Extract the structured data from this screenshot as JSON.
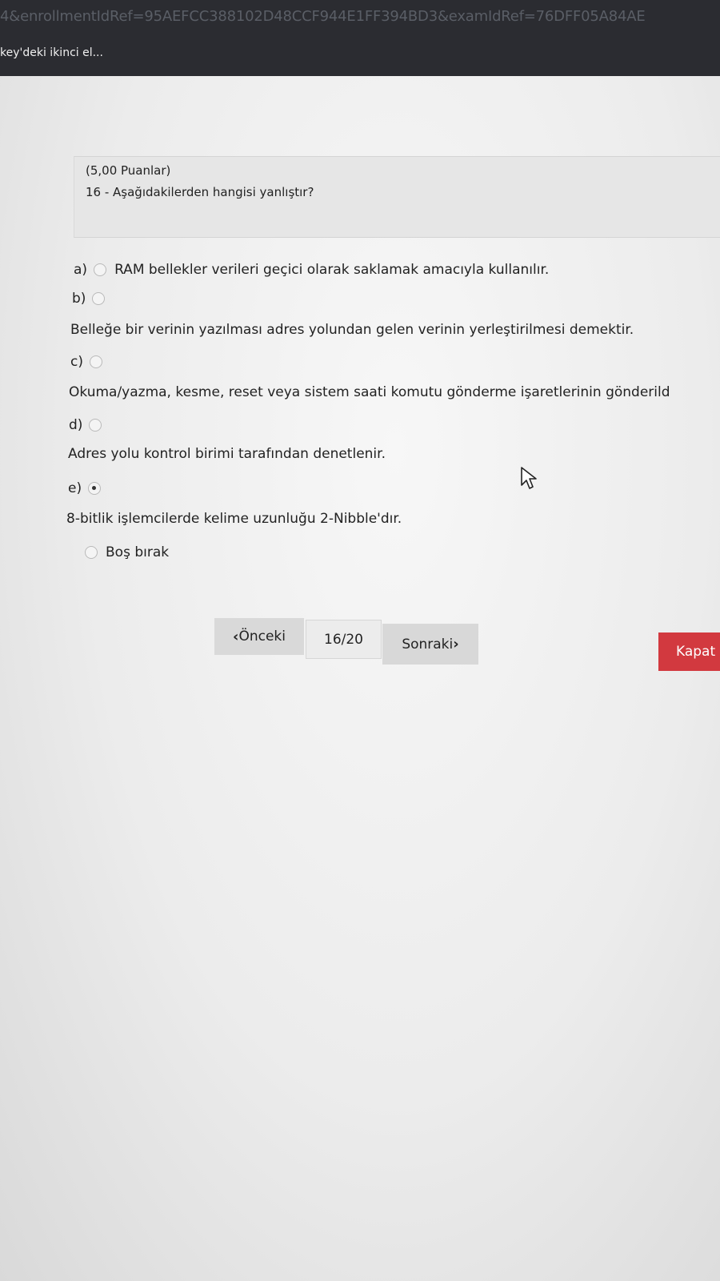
{
  "browser": {
    "url_fragment": "4&enrollmentIdRef=95AEFCC388102D48CCF944E1FF394BD3&examIdRef=76DFF05A84AE",
    "tab_title": "key'deki ikinci el..."
  },
  "question": {
    "points": "(5,00 Puanlar)",
    "text": "16 -  Aşağıdakilerden hangisi yanlıştır?"
  },
  "options": [
    {
      "letter": "a)",
      "text": "RAM bellekler verileri geçici olarak saklamak amacıyla kullanılır.",
      "selected": false
    },
    {
      "letter": "b)",
      "text": "Belleğe bir verinin yazılması adres yolundan gelen verinin yerleştirilmesi demektir.",
      "selected": false
    },
    {
      "letter": "c)",
      "text": "Okuma/yazma, kesme, reset veya sistem saati komutu gönderme işaretlerinin gönderild",
      "selected": false
    },
    {
      "letter": "d)",
      "text": "Adres yolu kontrol birimi tarafından denetlenir.",
      "selected": false
    },
    {
      "letter": "e)",
      "text": "8-bitlik işlemcilerde kelime uzunluğu 2-Nibble'dır.",
      "selected": true
    }
  ],
  "blank_option": {
    "text": "Boş bırak",
    "selected": false
  },
  "nav": {
    "prev_icon": "‹",
    "prev_label": "Önceki",
    "page": "16/20",
    "next_label": "Sonraki",
    "next_icon": "›",
    "close_label": "Kapat"
  },
  "colors": {
    "topbar": "#2b2c31",
    "close_button": "#d2393f"
  }
}
